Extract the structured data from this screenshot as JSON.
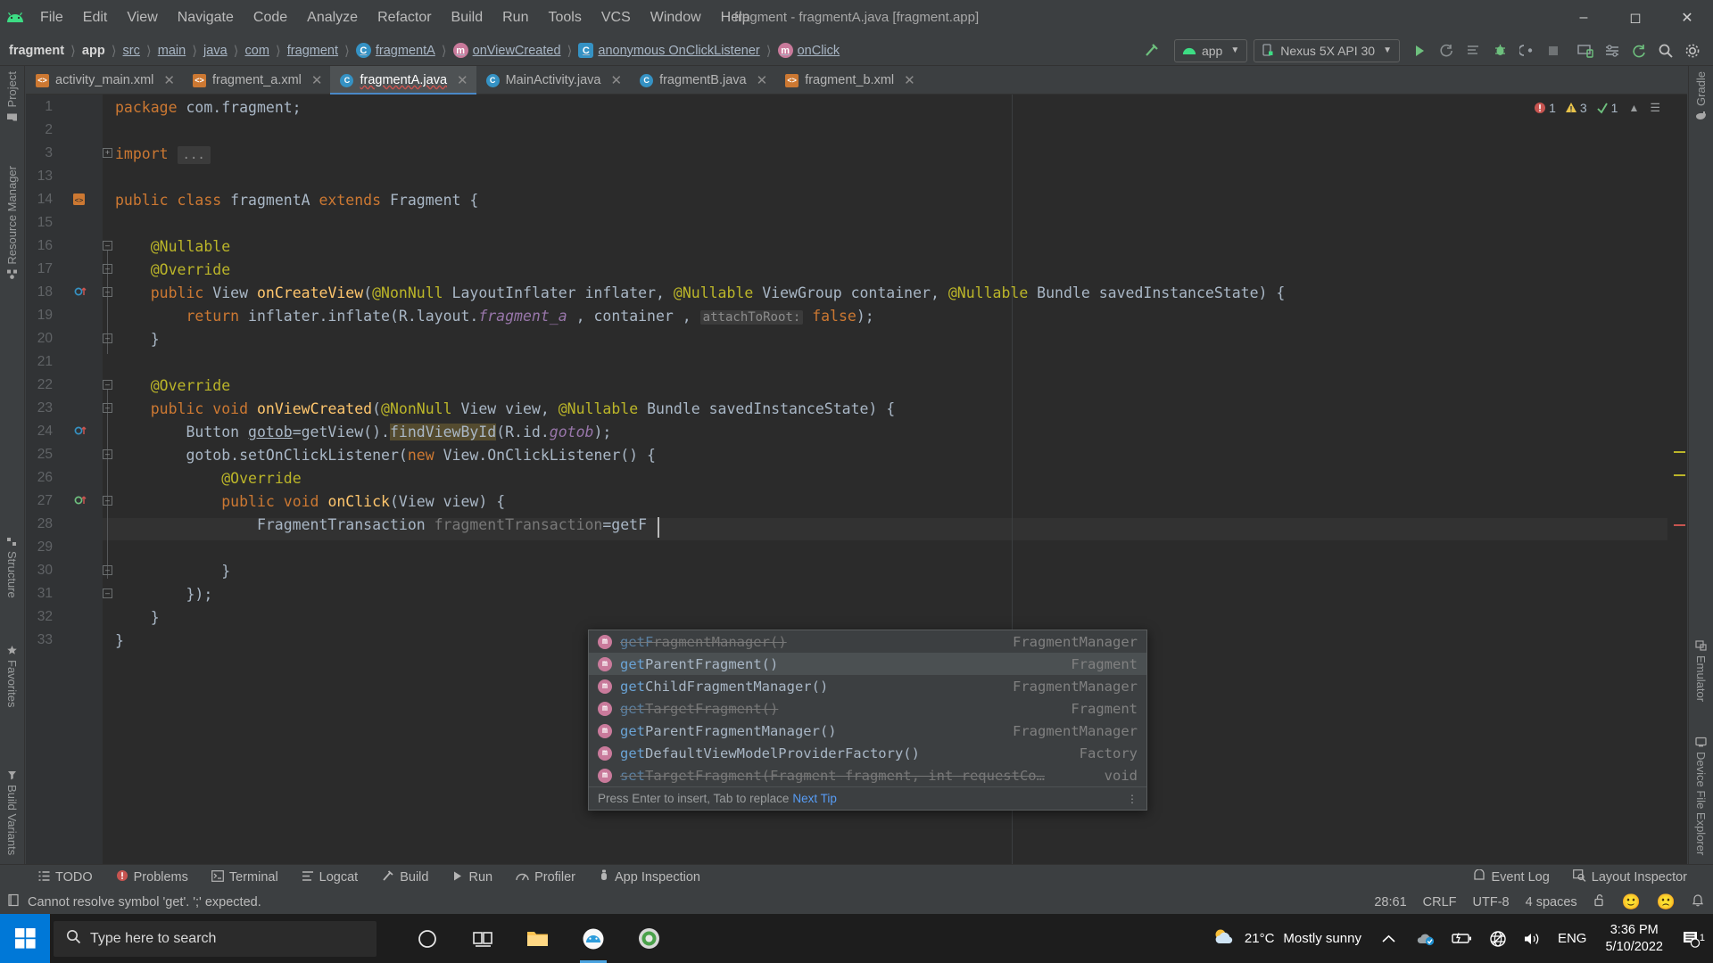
{
  "window": {
    "title": "fragment - fragmentA.java [fragment.app]",
    "minimize": "—",
    "maximize": "▢",
    "close": "✕"
  },
  "menu": [
    "File",
    "Edit",
    "View",
    "Navigate",
    "Code",
    "Analyze",
    "Refactor",
    "Build",
    "Run",
    "Tools",
    "VCS",
    "Window",
    "Help"
  ],
  "breadcrumb": [
    {
      "label": "fragment",
      "style": "bold"
    },
    {
      "label": "app",
      "style": "bold"
    },
    {
      "label": "src",
      "style": "link"
    },
    {
      "label": "main",
      "style": "link"
    },
    {
      "label": "java",
      "style": "link"
    },
    {
      "label": "com",
      "style": "link"
    },
    {
      "label": "fragment",
      "style": "link"
    },
    {
      "label": "fragmentA",
      "style": "class",
      "icon": "class-icon"
    },
    {
      "label": "onViewCreated",
      "style": "method",
      "icon": "method-icon"
    },
    {
      "label": "anonymous OnClickListener",
      "style": "anon",
      "icon": "anonymous-class-icon"
    },
    {
      "label": "onClick",
      "style": "method",
      "icon": "method-icon"
    }
  ],
  "toolbar": {
    "module_selector": "app",
    "device_selector": "Nexus 5X API 30",
    "dropdown_glyph": "▼",
    "icons": [
      "build-hammer-icon",
      "run-icon",
      "apply-changes-icon",
      "apply-code-changes-icon",
      "debug-icon",
      "attach-debugger-icon",
      "stop-icon",
      "avd-manager-icon",
      "sdk-manager-icon",
      "sync-gradle-icon",
      "search-icon",
      "settings-icon"
    ]
  },
  "tabs": [
    {
      "label": "activity_main.xml",
      "type": "xml",
      "active": false
    },
    {
      "label": "fragment_a.xml",
      "type": "xml",
      "active": false
    },
    {
      "label": "fragmentA.java",
      "type": "java",
      "active": true
    },
    {
      "label": "MainActivity.java",
      "type": "java",
      "active": false
    },
    {
      "label": "fragmentB.java",
      "type": "java",
      "active": false
    },
    {
      "label": "fragment_b.xml",
      "type": "xml",
      "active": false
    }
  ],
  "left_tool_tabs": [
    {
      "label": "Project",
      "icon": "project-icon"
    },
    {
      "label": "Resource Manager",
      "icon": "resource-manager-icon"
    },
    {
      "label": "Structure",
      "icon": "structure-icon"
    },
    {
      "label": "Favorites",
      "icon": "favorites-star-icon"
    },
    {
      "label": "Build Variants",
      "icon": "build-variants-icon"
    }
  ],
  "right_tool_tabs": [
    {
      "label": "Gradle",
      "icon": "gradle-elephant-icon"
    },
    {
      "label": "Emulator",
      "icon": "emulator-icon"
    },
    {
      "label": "Device File Explorer",
      "icon": "device-file-explorer-icon"
    }
  ],
  "editor": {
    "line_numbers": [
      "1",
      "2",
      "3",
      "13",
      "14",
      "15",
      "16",
      "17",
      "18",
      "19",
      "20",
      "21",
      "22",
      "23",
      "24",
      "25",
      "26",
      "27",
      "28",
      "29",
      "30",
      "31",
      "32",
      "33"
    ],
    "code_lines": [
      "package com.fragment;",
      "",
      "import ...",
      "",
      "public class fragmentA extends Fragment {",
      "",
      "    @Nullable",
      "    @Override",
      "    public View onCreateView(@NonNull LayoutInflater inflater, @Nullable ViewGroup container, @Nullable Bundle savedInstanceState) {",
      "        return inflater.inflate(R.layout.fragment_a , container , attachToRoot: false);",
      "    }",
      "",
      "    @Override",
      "    public void onViewCreated(@NonNull View view, @Nullable Bundle savedInstanceState) {",
      "        Button gotob=getView().findViewById(R.id.gotob);",
      "        gotob.setOnClickListener(new View.OnClickListener() {",
      "            @Override",
      "            public void onClick(View view) {",
      "                FragmentTransaction fragmentTransaction=getF",
      "",
      "            }",
      "        });",
      "    }",
      "}"
    ],
    "inspection": {
      "errors": "1",
      "warnings": "3",
      "weak_warnings": "1"
    }
  },
  "completion": {
    "items": [
      {
        "name": "getF",
        "name_rest": "ragmentManager",
        "args": "()",
        "type": "FragmentManager",
        "deprecated": true,
        "selected": false
      },
      {
        "name": "get",
        "name_rest": "ParentFragment",
        "args": "()",
        "type": "Fragment",
        "deprecated": false,
        "selected": true
      },
      {
        "name": "get",
        "name_rest": "ChildFragmentManager",
        "args": "()",
        "type": "FragmentManager",
        "deprecated": false,
        "selected": false
      },
      {
        "name": "get",
        "name_rest": "TargetFragment",
        "args": "()",
        "type": "Fragment",
        "deprecated": true,
        "selected": false
      },
      {
        "name": "get",
        "name_rest": "ParentFragmentManager",
        "args": "()",
        "type": "FragmentManager",
        "deprecated": false,
        "selected": false
      },
      {
        "name": "get",
        "name_rest": "DefaultViewModelProviderFactory",
        "args": "()",
        "type": "Factory",
        "deprecated": false,
        "selected": false
      },
      {
        "name": "set",
        "name_rest": "TargetFragment",
        "args": "(Fragment fragment, int requestCo…",
        "type": "void",
        "deprecated": true,
        "selected": false
      }
    ],
    "hint_text": "Press Enter to insert, Tab to replace",
    "hint_link": "Next Tip"
  },
  "bottom_tools": [
    {
      "label": "TODO",
      "icon": "todo-icon"
    },
    {
      "label": "Problems",
      "icon": "problems-icon"
    },
    {
      "label": "Terminal",
      "icon": "terminal-icon"
    },
    {
      "label": "Logcat",
      "icon": "logcat-icon"
    },
    {
      "label": "Build",
      "icon": "build-hammer-icon"
    },
    {
      "label": "Run",
      "icon": "run-icon"
    },
    {
      "label": "Profiler",
      "icon": "profiler-icon"
    },
    {
      "label": "App Inspection",
      "icon": "app-inspection-icon"
    }
  ],
  "right_bottom_tools": [
    {
      "label": "Event Log",
      "icon": "event-log-icon"
    },
    {
      "label": "Layout Inspector",
      "icon": "layout-inspector-icon"
    }
  ],
  "status": {
    "message": "Cannot resolve symbol 'get'. ';' expected.",
    "caret_position": "28:61",
    "line_separator": "CRLF",
    "encoding": "UTF-8",
    "indent": "4 spaces",
    "lock_icon": "unlocked-padlock-icon",
    "feedback_happy": "🙂",
    "feedback_sad": "🙁"
  },
  "taskbar": {
    "search_placeholder": "Type here to search",
    "apps": [
      {
        "name": "cortana-icon"
      },
      {
        "name": "task-view-icon"
      },
      {
        "name": "file-explorer-icon"
      },
      {
        "name": "android-studio-icon"
      },
      {
        "name": "chrome-icon"
      }
    ],
    "weather_temp": "21°C",
    "weather_desc": "Mostly sunny",
    "language": "ENG",
    "time": "3:36 PM",
    "date": "5/10/2022",
    "notification_count": "1"
  },
  "colors": {
    "accent": "#4a88c7",
    "panel": "#3c3f41",
    "editor_bg": "#2b2b2b",
    "keyword": "#cc7832",
    "string": "#6a8759",
    "number": "#6897bb",
    "annotation": "#bbb529",
    "field": "#9876aa",
    "method": "#ffc66d",
    "error": "#c75450",
    "taskbar": "#1d1d1d",
    "start": "#0078d7"
  }
}
